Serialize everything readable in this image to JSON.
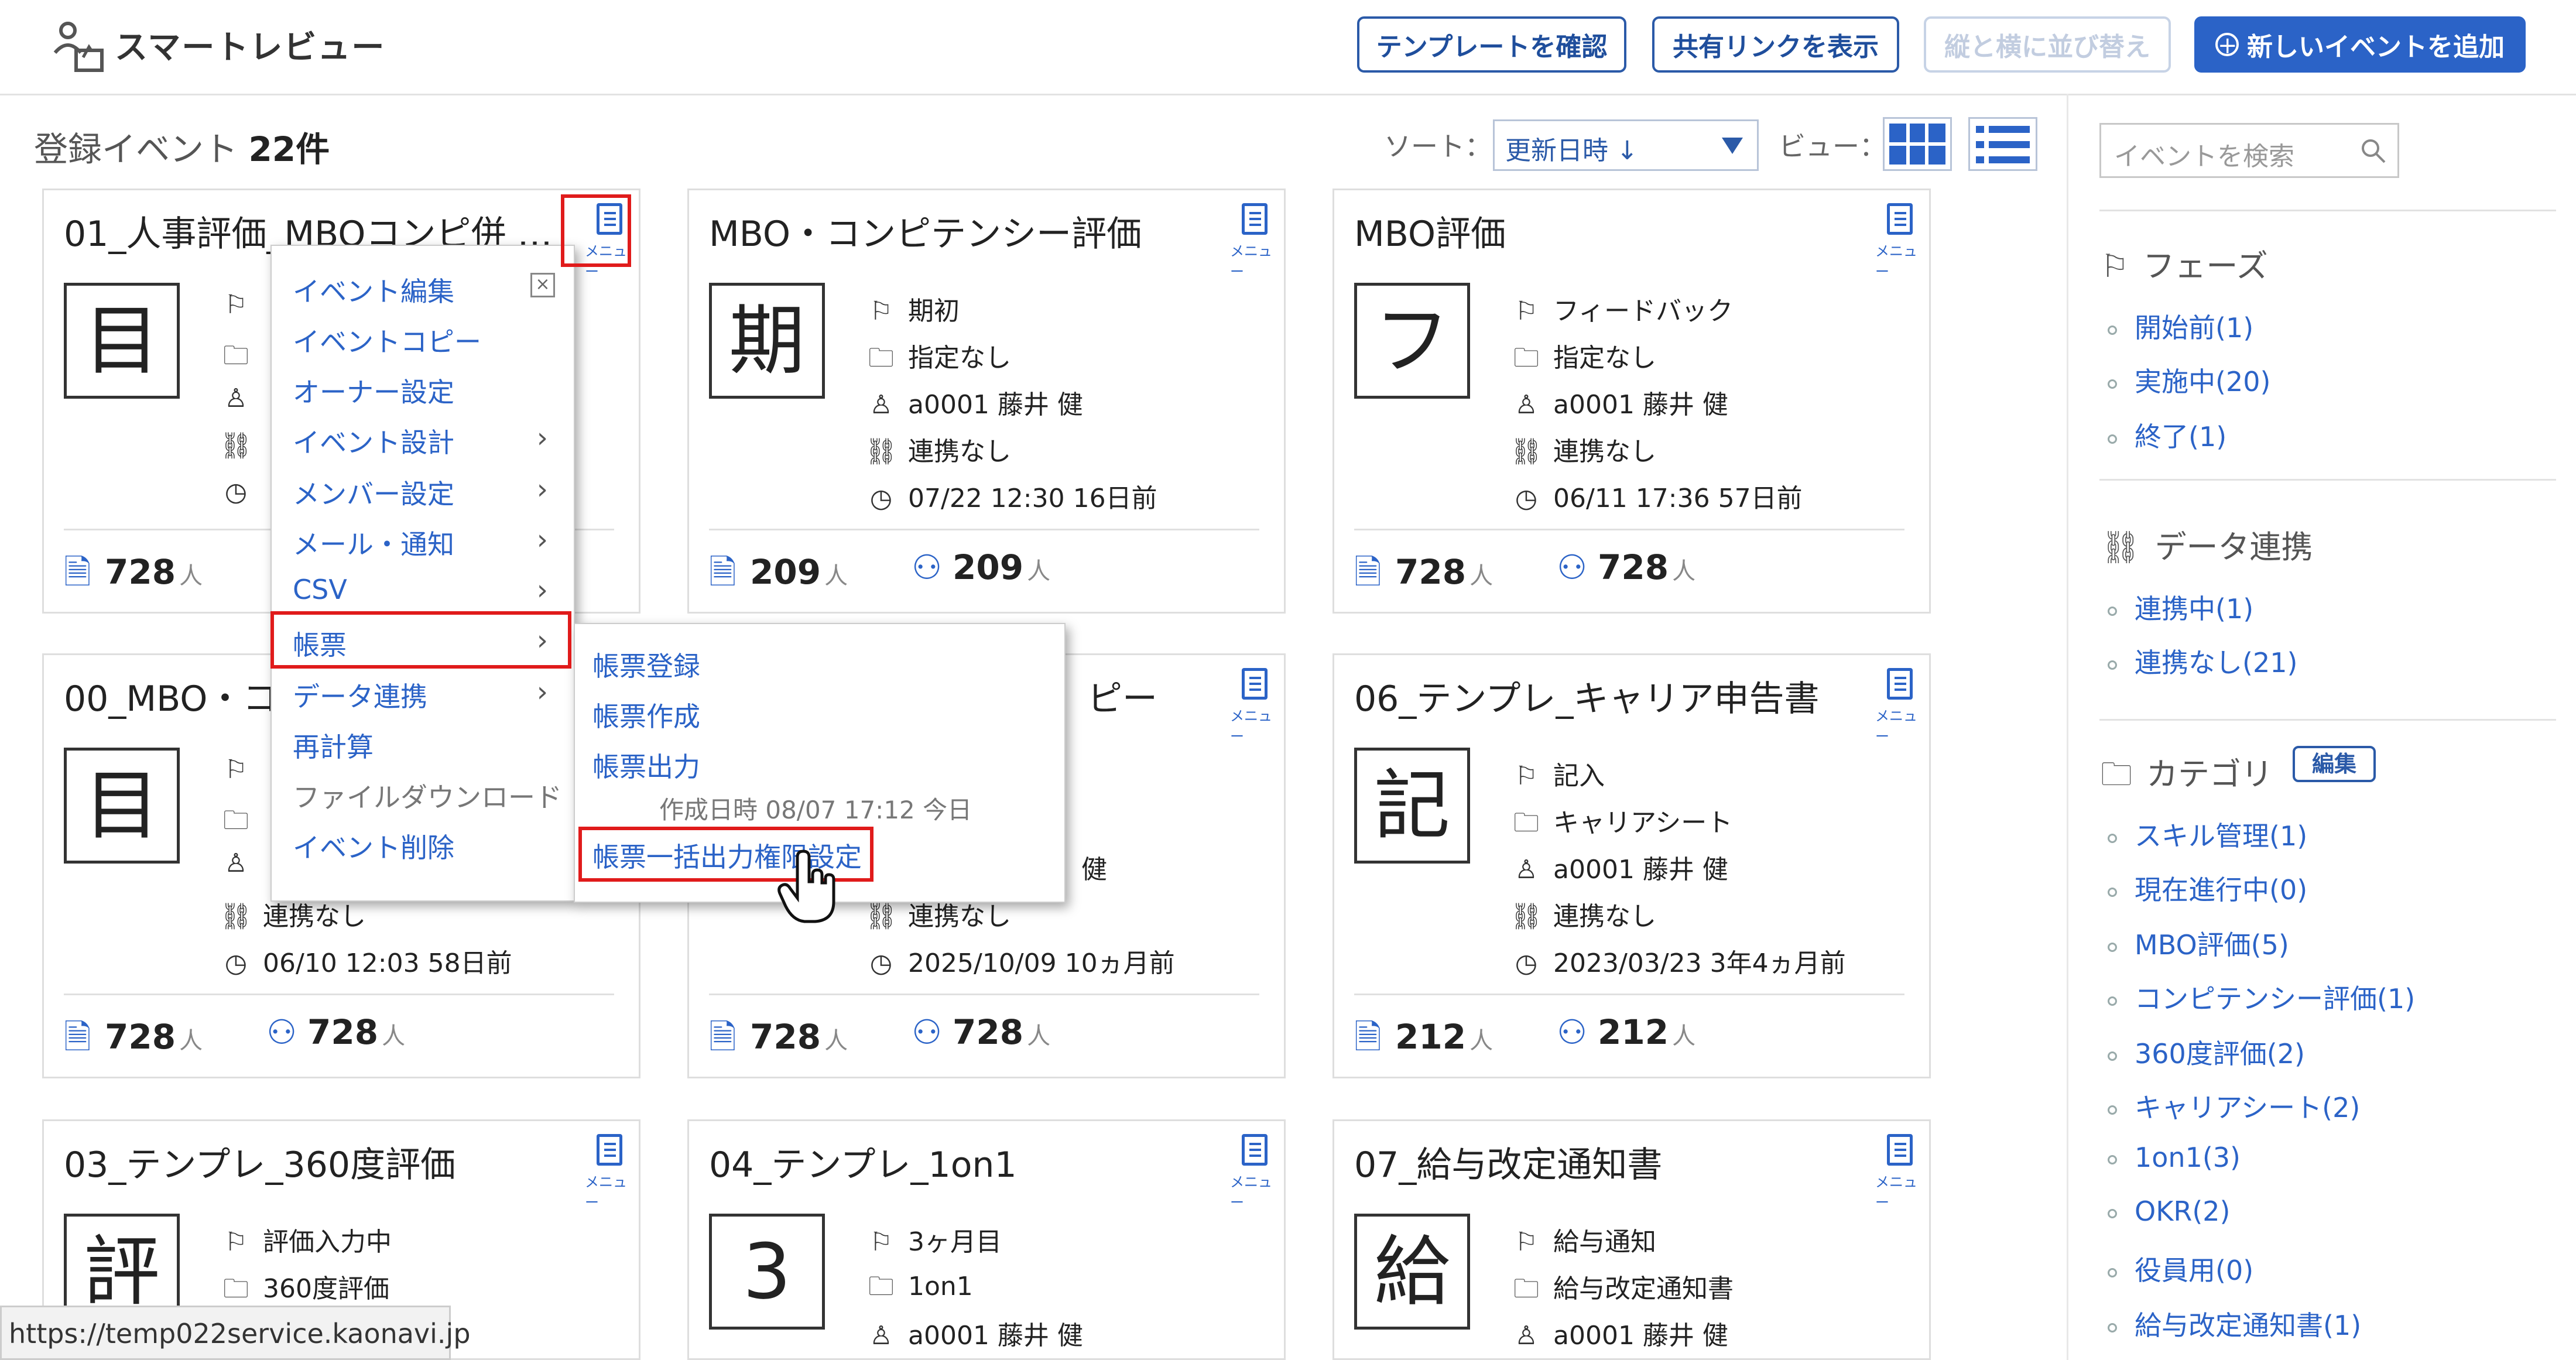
{
  "app": {
    "title": "スマートレビュー"
  },
  "header": {
    "buttons": {
      "confirm_template": "テンプレートを確認",
      "show_share_link": "共有リンクを表示",
      "rearrange": "縦と横に並び替え",
      "add_event": "新しいイベントを追加"
    }
  },
  "toolbar": {
    "count_label": "登録イベント",
    "count_value": "22件",
    "sort_label": "ソート：",
    "sort_value": "更新日時 ↓",
    "view_label": "ビュー："
  },
  "sidebar": {
    "search_placeholder": "イベントを検索",
    "phase": {
      "title": "フェーズ",
      "items": [
        "開始前(1)",
        "実施中(20)",
        "終了(1)"
      ]
    },
    "data_link": {
      "title": "データ連携",
      "items": [
        "連携中(1)",
        "連携なし(21)"
      ]
    },
    "category": {
      "title": "カテゴリ",
      "edit_label": "編集",
      "items": [
        "スキル管理(1)",
        "現在進行中(0)",
        "MBO評価(5)",
        "コンピテンシー評価(1)",
        "360度評価(2)",
        "キャリアシート(2)",
        "1on1(3)",
        "OKR(2)",
        "役員用(0)",
        "給与改定通知書(1)"
      ]
    }
  },
  "menu_caption": "メニュー",
  "cards": [
    {
      "title": "01_人事評価_MBOコンピ併",
      "ellipsis": "…",
      "char": "目",
      "count1": "728",
      "unit": "人"
    },
    {
      "title": "MBO・コンピテンシー評価",
      "char": "期",
      "phase": "期初",
      "category": "指定なし",
      "owner": "a0001 藤井 健",
      "link": "連携なし",
      "updated": "07/22 12:30 16日前",
      "count1": "209",
      "count2": "209",
      "unit": "人"
    },
    {
      "title": "MBO評価",
      "char": "フ",
      "phase": "フィードバック",
      "category": "指定なし",
      "owner": "a0001 藤井 健",
      "link": "連携なし",
      "updated": "06/11 17:36 57日前",
      "count1": "728",
      "count2": "728",
      "unit": "人"
    },
    {
      "title": "00_MBO・コ",
      "char": "目",
      "link": "連携なし",
      "updated": "06/10 12:03 58日前",
      "count1": "728",
      "count2": "728",
      "unit": "人"
    },
    {
      "title_tail": "ピー",
      "owner_tail": "健",
      "link": "連携なし",
      "updated": "2025/10/09 10ヵ月前",
      "count1": "728",
      "count2": "728",
      "unit": "人"
    },
    {
      "title": "06_テンプレ_キャリア申告書",
      "char": "記",
      "phase": "記入",
      "category": "キャリアシート",
      "owner": "a0001 藤井 健",
      "link": "連携なし",
      "updated": "2023/03/23 3年4ヵ月前",
      "count1": "212",
      "count2": "212",
      "unit": "人"
    },
    {
      "title": "03_テンプレ_360度評価",
      "char": "評",
      "phase": "評価入力中",
      "category": "360度評価"
    },
    {
      "title": "04_テンプレ_1on1",
      "char": "3",
      "phase": "3ヶ月目",
      "category": "1on1",
      "owner": "a0001 藤井 健"
    },
    {
      "title": "07_給与改定通知書",
      "char": "給",
      "phase": "給与通知",
      "category": "給与改定通知書",
      "owner": "a0001 藤井 健"
    }
  ],
  "context_menu": {
    "items": [
      "イベント編集",
      "イベントコピー",
      "オーナー設定",
      "イベント設計",
      "メンバー設定",
      "メール・通知",
      "CSV",
      "帳票",
      "データ連携",
      "再計算",
      "ファイルダウンロード",
      "イベント削除"
    ]
  },
  "submenu": {
    "items": [
      "帳票登録",
      "帳票作成",
      "帳票出力"
    ],
    "created_note": "作成日時 08/07 17:12 今日",
    "bulk_permission": "帳票一括出力権限設定"
  },
  "status_bar": {
    "url": "https://temp022service.kaonavi.jp"
  },
  "colors": {
    "accent": "#2b63c7",
    "highlight": "#e01b1b"
  }
}
